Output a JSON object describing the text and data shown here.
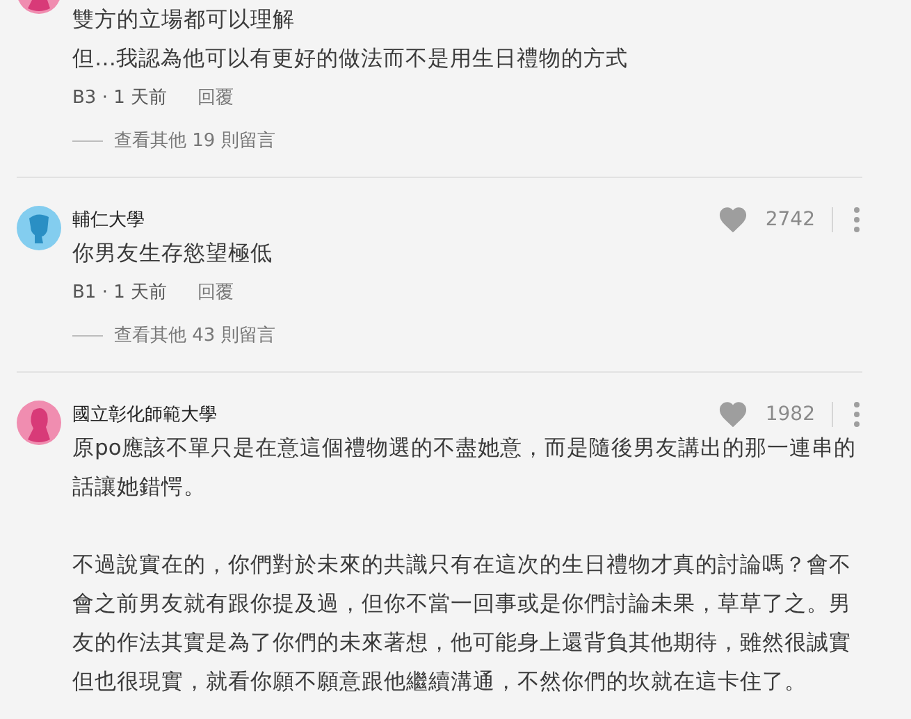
{
  "comments": [
    {
      "avatar": {
        "kind": "female"
      },
      "body": [
        [
          "雙方的立場都可以理解",
          "但…我認為他可以有更好的做法而不是用生日禮物的方式"
        ]
      ],
      "meta": "B3 · 1 天前",
      "reply": "回覆",
      "more": "查看其他 19 則留言"
    },
    {
      "avatar": {
        "kind": "male"
      },
      "name": "輔仁大學",
      "likes": "2742",
      "body": [
        [
          "你男友生存慾望極低"
        ]
      ],
      "meta": "B1 · 1 天前",
      "reply": "回覆",
      "more": "查看其他 43 則留言"
    },
    {
      "avatar": {
        "kind": "female"
      },
      "name": "國立彰化師範大學",
      "likes": "1982",
      "body": [
        [
          "原po應該不單只是在意這個禮物選的不盡她意，而是隨後男友講出的那一連串的話讓她錯愕。"
        ],
        [
          "不過說實在的，你們對於未來的共識只有在這次的生日禮物才真的討論嗎？會不會之前男友就有跟你提及過，但你不當一回事或是你們討論未果，草草了之。男友的作法其實是為了你們的未來著想，他可能身上還背負其他期待，雖然很誠實但也很現實，就看你願不願意跟他繼續溝通，不然你們的坎就在這卡住了。"
        ]
      ]
    }
  ]
}
